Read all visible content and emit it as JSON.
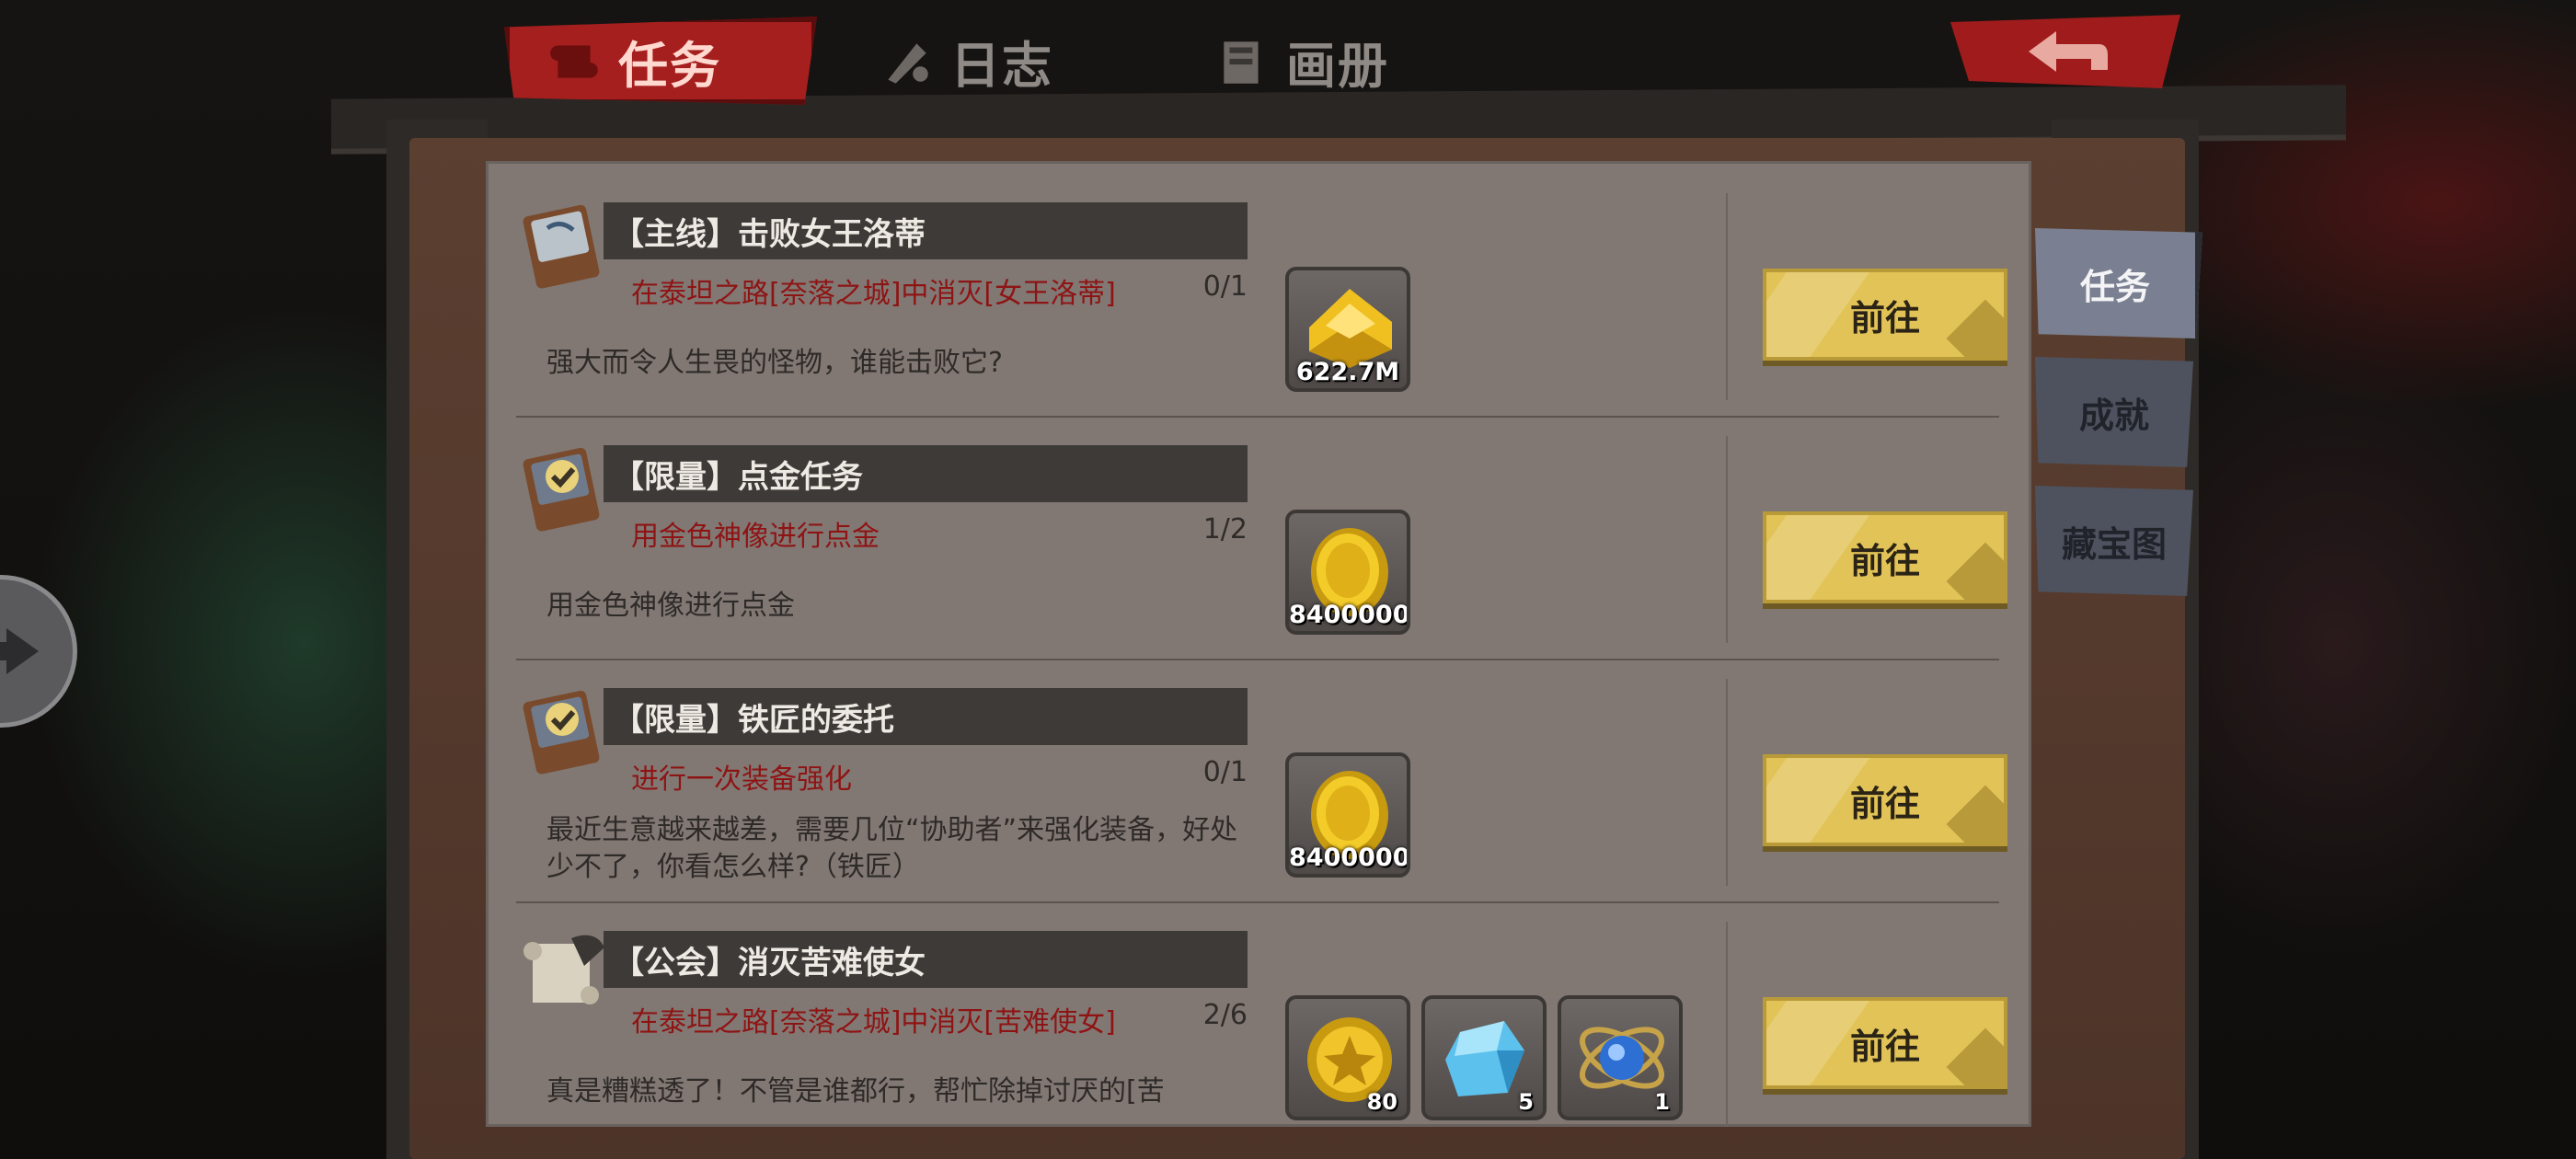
{
  "top_tabs": [
    {
      "label": "任务",
      "icon": "scroll-icon",
      "active": true
    },
    {
      "label": "日志",
      "icon": "quill-icon",
      "active": false
    },
    {
      "label": "画册",
      "icon": "book-icon",
      "active": false
    }
  ],
  "back_button": {
    "icon": "back-arrow-icon"
  },
  "quests": [
    {
      "title": "【主线】击败女王洛蒂",
      "objective": "在泰坦之路[奈落之城]中消灭[女王洛蒂]",
      "progress": "0/1",
      "description": "强大而令人生畏的怪物，谁能击败它?",
      "icon": "quest-book-icon",
      "rewards": [
        {
          "icon": "gold-bar-icon",
          "count": "622.7M"
        }
      ],
      "button": "前往"
    },
    {
      "title": "【限量】点金任务",
      "objective": "用金色神像进行点金",
      "progress": "1/2",
      "description": "用金色神像进行点金",
      "icon": "quest-book-check-icon",
      "rewards": [
        {
          "icon": "gold-coin-icon",
          "count": "8400000"
        }
      ],
      "button": "前往"
    },
    {
      "title": "【限量】铁匠的委托",
      "objective": "进行一次装备强化",
      "progress": "0/1",
      "description": "最近生意越来越差，需要几位“协助者”来强化装备，好处少不了，你看怎么样?（铁匠）",
      "icon": "quest-book-check-icon",
      "rewards": [
        {
          "icon": "gold-coin-icon",
          "count": "8400000"
        }
      ],
      "button": "前往"
    },
    {
      "title": "【公会】消灭苦难使女",
      "objective": "在泰坦之路[奈落之城]中消灭[苦难使女]",
      "progress": "2/6",
      "description": "真是糟糕透了！不管是谁都行，帮忙除掉讨厌的[苦",
      "icon": "quest-scroll-icon",
      "rewards": [
        {
          "icon": "guild-medal-icon",
          "count": "80"
        },
        {
          "icon": "blue-crystal-icon",
          "count": "5"
        },
        {
          "icon": "sapphire-orb-icon",
          "count": "1"
        }
      ],
      "button": "前往"
    }
  ],
  "side_tabs": [
    {
      "label": "任务",
      "active": true
    },
    {
      "label": "成就",
      "active": false
    },
    {
      "label": "藏宝图",
      "active": false
    }
  ],
  "colors": {
    "panel": "#817874",
    "title_bar": "#3e3a38",
    "objective_text": "#8e1414",
    "go_button": "#e2c357",
    "active_tab_red": "#a51f1f"
  }
}
